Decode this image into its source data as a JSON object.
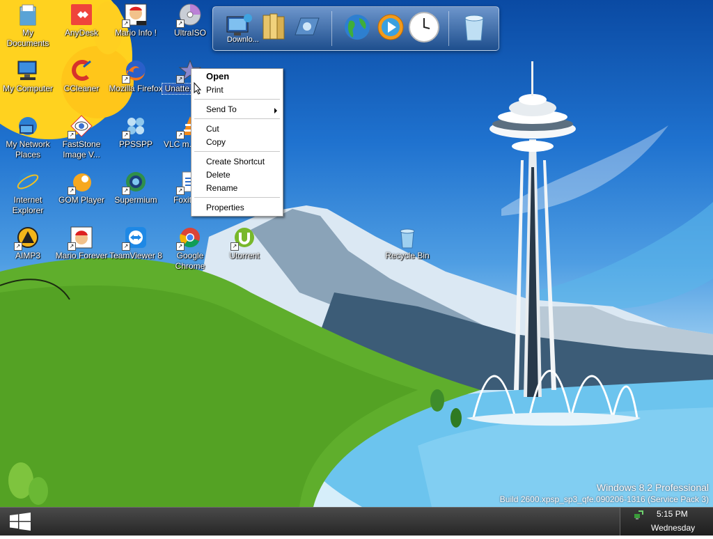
{
  "desktop_icons": [
    {
      "label": "My Documents",
      "icon": "folder-documents-icon"
    },
    {
      "label": "AnyDesk",
      "icon": "anydesk-icon"
    },
    {
      "label": "Mario Info !",
      "icon": "mario-info-icon"
    },
    {
      "label": "UltraISO",
      "icon": "ultraiso-icon"
    },
    {
      "label": "My Computer",
      "icon": "computer-icon"
    },
    {
      "label": "CCleaner",
      "icon": "ccleaner-icon"
    },
    {
      "label": "Mozilla Firefox",
      "icon": "firefox-icon"
    },
    {
      "label": "Unatte... Sc...",
      "icon": "unattended-setup-icon",
      "selected": true
    },
    {
      "label": "My Network Places",
      "icon": "network-places-icon"
    },
    {
      "label": "FastStone Image V...",
      "icon": "faststone-icon"
    },
    {
      "label": "PPSSPP",
      "icon": "ppsspp-icon"
    },
    {
      "label": "VLC m... pla...",
      "icon": "vlc-icon"
    },
    {
      "label": "Internet Explorer",
      "icon": "internet-explorer-icon"
    },
    {
      "label": "GOM Player",
      "icon": "gom-player-icon"
    },
    {
      "label": "Supermium",
      "icon": "supermium-icon"
    },
    {
      "label": "Foxit R...",
      "icon": "foxit-reader-icon"
    },
    {
      "label": "AIMP3",
      "icon": "aimp-icon"
    },
    {
      "label": "Mario Forever",
      "icon": "mario-forever-icon"
    },
    {
      "label": "TeamViewer 8",
      "icon": "teamviewer-icon"
    },
    {
      "label": "Google Chrome",
      "icon": "chrome-icon"
    },
    {
      "label": "Utorrent",
      "icon": "utorrent-icon"
    },
    {
      "label": "Recycle Bin",
      "icon": "recycle-bin-icon"
    }
  ],
  "dock": {
    "partial_label": "Downlo...",
    "items": [
      "network-computer-icon",
      "folders-icon",
      "control-panel-icon",
      "globe-icon",
      "media-player-icon",
      "clock-icon",
      "trash-icon"
    ]
  },
  "context_menu": {
    "items": [
      {
        "label": "Open",
        "bold": true
      },
      {
        "label": "Print"
      },
      {
        "label": "Send To",
        "submenu": true
      },
      {
        "label": "Cut"
      },
      {
        "label": "Copy"
      },
      {
        "label": "Create Shortcut"
      },
      {
        "label": "Delete"
      },
      {
        "label": "Rename"
      },
      {
        "label": "Properties"
      }
    ]
  },
  "watermark": {
    "title": "Windows 8.2 Professional",
    "build": "Build 2600.xpsp_sp3_qfe.090206-1316 (Service Pack 3)"
  },
  "taskbar": {
    "start_icon": "windows-logo-icon",
    "tray_icon": "network-tray-icon",
    "time": "5:15 PM",
    "day": "Wednesday"
  },
  "colors": {
    "sky": "#1f72cf",
    "hill": "#5fae2c",
    "water": "#6cc4ee",
    "sun": "#ffd21f",
    "taskbar": "#2e2e2e"
  }
}
